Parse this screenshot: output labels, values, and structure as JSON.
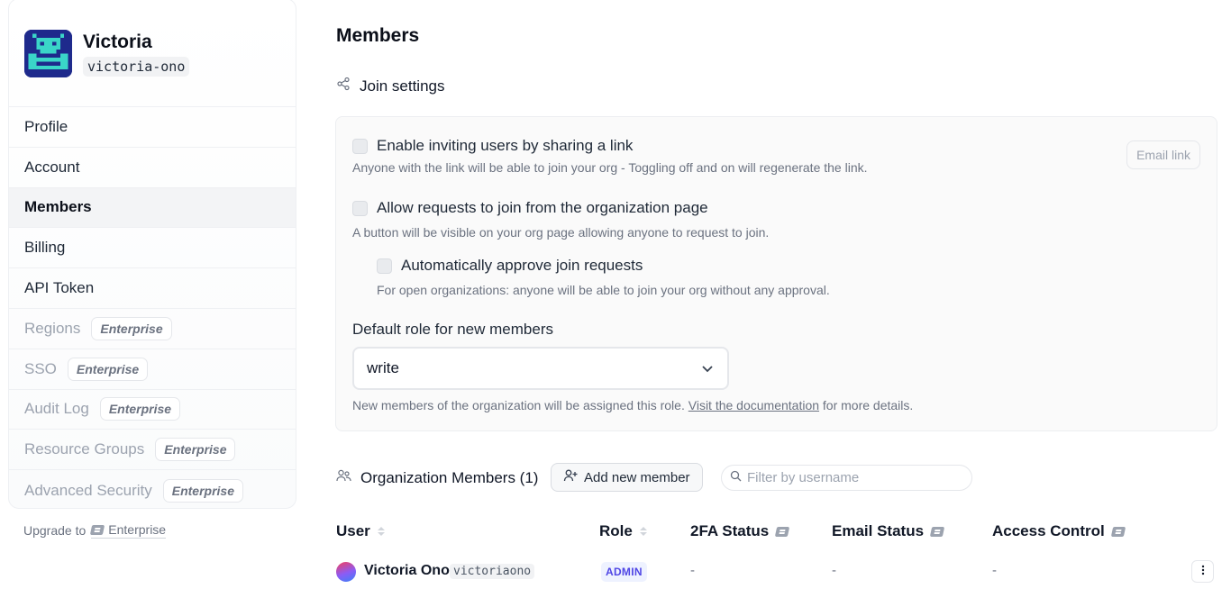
{
  "org": {
    "name": "Victoria",
    "handle": "victoria-ono"
  },
  "sidebar": {
    "items": [
      {
        "label": "Profile"
      },
      {
        "label": "Account"
      },
      {
        "label": "Members"
      },
      {
        "label": "Billing"
      },
      {
        "label": "API Token"
      },
      {
        "label": "Regions",
        "badge": "Enterprise"
      },
      {
        "label": "SSO",
        "badge": "Enterprise"
      },
      {
        "label": "Audit Log",
        "badge": "Enterprise"
      },
      {
        "label": "Resource Groups",
        "badge": "Enterprise"
      },
      {
        "label": "Advanced Security",
        "badge": "Enterprise"
      }
    ],
    "upgrade_text": "Upgrade to",
    "upgrade_link": "Enterprise"
  },
  "main": {
    "title": "Members",
    "join_settings": {
      "heading": "Join settings",
      "invite_link": {
        "label": "Enable inviting users by sharing a link",
        "hint": "Anyone with the link will be able to join your org - Toggling off and on will regenerate the link.",
        "button": "Email link"
      },
      "allow_requests": {
        "label": "Allow requests to join from the organization page",
        "hint": "A button will be visible on your org page allowing anyone to request to join."
      },
      "auto_approve": {
        "label": "Automatically approve join requests",
        "hint": "For open organizations: anyone will be able to join your org without any approval."
      },
      "default_role": {
        "label": "Default role for new members",
        "value": "write",
        "hint_before": "New members of the organization will be assigned this role.",
        "hint_link": "Visit the documentation",
        "hint_after": "for more details."
      }
    },
    "members": {
      "heading": "Organization Members (1)",
      "add_button": "Add new member",
      "filter_placeholder": "Filter by username",
      "columns": {
        "user": "User",
        "role": "Role",
        "twofa": "2FA Status",
        "email": "Email Status",
        "access": "Access Control"
      },
      "rows": [
        {
          "name": "Victoria Ono",
          "handle": "victoriaono",
          "role": "ADMIN",
          "twofa": "-",
          "email": "-",
          "access": "-"
        }
      ]
    }
  }
}
